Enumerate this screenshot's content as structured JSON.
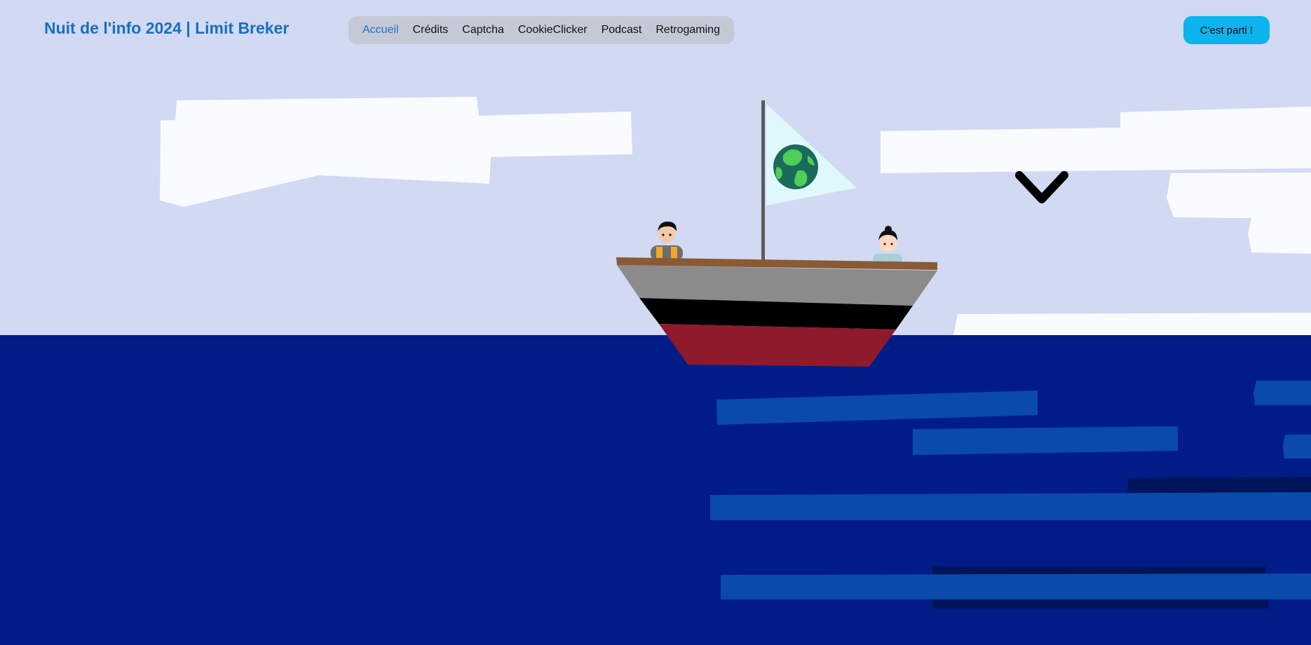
{
  "header": {
    "brand": "Nuit de l'info 2024 | Limit Breker",
    "nav": [
      {
        "label": "Accueil",
        "active": true
      },
      {
        "label": "Crédits",
        "active": false
      },
      {
        "label": "Captcha",
        "active": false
      },
      {
        "label": "CookieClicker",
        "active": false
      },
      {
        "label": "Podcast",
        "active": false
      },
      {
        "label": "Retrogaming",
        "active": false
      }
    ],
    "cta_label": "C'est parti !"
  },
  "icons": {
    "scroll": "chevron-down-icon",
    "flag": "earth-icon"
  },
  "colors": {
    "sky": "#d1d9f3",
    "sea": "#001c87",
    "brand": "#1a6fbd",
    "nav_active": "#1e6fc9",
    "cta": "#0bb4ec",
    "hull_top": "#8b8b8b",
    "hull_stripe": "#000000",
    "hull_bottom": "#8e1a2b",
    "deck": "#8a5a35",
    "wave": "#0a4aa8"
  }
}
